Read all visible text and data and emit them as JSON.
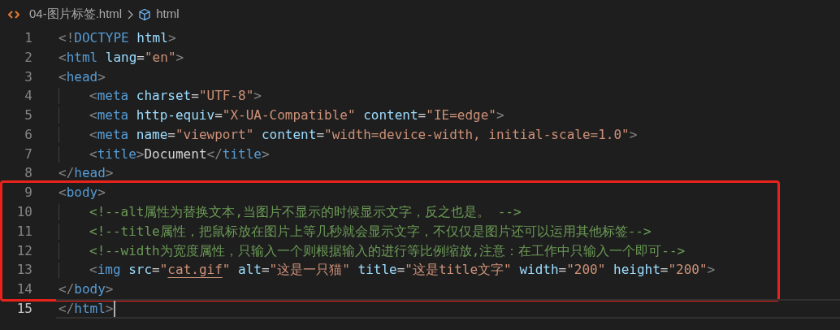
{
  "breadcrumb": {
    "file": "04-图片标签.html",
    "symbol": "html"
  },
  "blocks": [
    {
      "boxed": false,
      "lines": [
        {
          "number": "1",
          "indented": false,
          "current": false,
          "tokens": [
            {
              "kind": "punct",
              "text": "<!"
            },
            {
              "kind": "tag",
              "text": "DOCTYPE"
            },
            {
              "kind": "attr",
              "text": " html"
            },
            {
              "kind": "punct",
              "text": ">"
            }
          ]
        },
        {
          "number": "2",
          "indented": false,
          "current": false,
          "tokens": [
            {
              "kind": "punct",
              "text": "<"
            },
            {
              "kind": "tag",
              "text": "html"
            },
            {
              "kind": "attr",
              "text": " lang"
            },
            {
              "kind": "text",
              "text": "="
            },
            {
              "kind": "string",
              "text": "\"en\""
            },
            {
              "kind": "punct",
              "text": ">"
            }
          ]
        },
        {
          "number": "3",
          "indented": false,
          "current": false,
          "tokens": [
            {
              "kind": "punct",
              "text": "<"
            },
            {
              "kind": "tag",
              "text": "head"
            },
            {
              "kind": "punct",
              "text": ">"
            }
          ]
        },
        {
          "number": "4",
          "indented": true,
          "current": false,
          "tokens": [
            {
              "kind": "punct",
              "text": "<"
            },
            {
              "kind": "tag",
              "text": "meta"
            },
            {
              "kind": "attr",
              "text": " charset"
            },
            {
              "kind": "text",
              "text": "="
            },
            {
              "kind": "string",
              "text": "\"UTF-8\""
            },
            {
              "kind": "punct",
              "text": ">"
            }
          ]
        },
        {
          "number": "5",
          "indented": true,
          "current": false,
          "tokens": [
            {
              "kind": "punct",
              "text": "<"
            },
            {
              "kind": "tag",
              "text": "meta"
            },
            {
              "kind": "attr",
              "text": " http-equiv"
            },
            {
              "kind": "text",
              "text": "="
            },
            {
              "kind": "string",
              "text": "\"X-UA-Compatible\""
            },
            {
              "kind": "attr",
              "text": " content"
            },
            {
              "kind": "text",
              "text": "="
            },
            {
              "kind": "string",
              "text": "\"IE=edge\""
            },
            {
              "kind": "punct",
              "text": ">"
            }
          ]
        },
        {
          "number": "6",
          "indented": true,
          "current": false,
          "tokens": [
            {
              "kind": "punct",
              "text": "<"
            },
            {
              "kind": "tag",
              "text": "meta"
            },
            {
              "kind": "attr",
              "text": " name"
            },
            {
              "kind": "text",
              "text": "="
            },
            {
              "kind": "string",
              "text": "\"viewport\""
            },
            {
              "kind": "attr",
              "text": " content"
            },
            {
              "kind": "text",
              "text": "="
            },
            {
              "kind": "string",
              "text": "\"width=device-width, initial-scale=1.0\""
            },
            {
              "kind": "punct",
              "text": ">"
            }
          ]
        },
        {
          "number": "7",
          "indented": true,
          "current": false,
          "tokens": [
            {
              "kind": "punct",
              "text": "<"
            },
            {
              "kind": "tag",
              "text": "title"
            },
            {
              "kind": "punct",
              "text": ">"
            },
            {
              "kind": "text",
              "text": "Document"
            },
            {
              "kind": "punct",
              "text": "</"
            },
            {
              "kind": "tag",
              "text": "title"
            },
            {
              "kind": "punct",
              "text": ">"
            }
          ]
        },
        {
          "number": "8",
          "indented": false,
          "current": false,
          "tokens": [
            {
              "kind": "punct",
              "text": "</"
            },
            {
              "kind": "tag",
              "text": "head"
            },
            {
              "kind": "punct",
              "text": ">"
            }
          ]
        }
      ]
    },
    {
      "boxed": true,
      "lines": [
        {
          "number": "9",
          "indented": false,
          "current": false,
          "tokens": [
            {
              "kind": "punct",
              "text": "<"
            },
            {
              "kind": "tag",
              "text": "body"
            },
            {
              "kind": "punct",
              "text": ">"
            }
          ]
        },
        {
          "number": "10",
          "indented": true,
          "current": false,
          "tokens": [
            {
              "kind": "comment",
              "text": "<!--alt属性为替换文本,当图片不显示的时候显示文字，反之也是。 -->"
            }
          ]
        },
        {
          "number": "11",
          "indented": true,
          "current": false,
          "tokens": [
            {
              "kind": "comment",
              "text": "<!--title属性，把鼠标放在图片上等几秒就会显示文字，不仅仅是图片还可以运用其他标签-->"
            }
          ]
        },
        {
          "number": "12",
          "indented": true,
          "current": false,
          "tokens": [
            {
              "kind": "comment",
              "text": "<!--width为宽度属性，只输入一个则根据输入的进行等比例缩放,注意：在工作中只输入一个即可-->"
            }
          ]
        },
        {
          "number": "13",
          "indented": true,
          "current": false,
          "tokens": [
            {
              "kind": "punct",
              "text": "<"
            },
            {
              "kind": "tag",
              "text": "img"
            },
            {
              "kind": "attr",
              "text": " src"
            },
            {
              "kind": "text",
              "text": "="
            },
            {
              "kind": "string",
              "text": "\""
            },
            {
              "kind": "link",
              "text": "cat.gif"
            },
            {
              "kind": "string",
              "text": "\""
            },
            {
              "kind": "attr",
              "text": " alt"
            },
            {
              "kind": "text",
              "text": "="
            },
            {
              "kind": "string",
              "text": "\"这是一只猫\""
            },
            {
              "kind": "attr",
              "text": " title"
            },
            {
              "kind": "text",
              "text": "="
            },
            {
              "kind": "string",
              "text": "\"这是title文字\""
            },
            {
              "kind": "attr",
              "text": " width"
            },
            {
              "kind": "text",
              "text": "="
            },
            {
              "kind": "string",
              "text": "\"200\""
            },
            {
              "kind": "attr",
              "text": " height"
            },
            {
              "kind": "text",
              "text": "="
            },
            {
              "kind": "string",
              "text": "\"200\""
            },
            {
              "kind": "punct",
              "text": ">"
            }
          ]
        },
        {
          "number": "14",
          "indented": false,
          "current": false,
          "tokens": [
            {
              "kind": "punct",
              "text": "</"
            },
            {
              "kind": "tag",
              "text": "body"
            },
            {
              "kind": "punct",
              "text": ">"
            }
          ]
        }
      ]
    },
    {
      "boxed": false,
      "lines": [
        {
          "number": "15",
          "indented": false,
          "current": true,
          "tokens": [
            {
              "kind": "punct",
              "text": "</"
            },
            {
              "kind": "tag",
              "text": "html"
            },
            {
              "kind": "punct",
              "text": ">"
            }
          ]
        }
      ]
    }
  ]
}
